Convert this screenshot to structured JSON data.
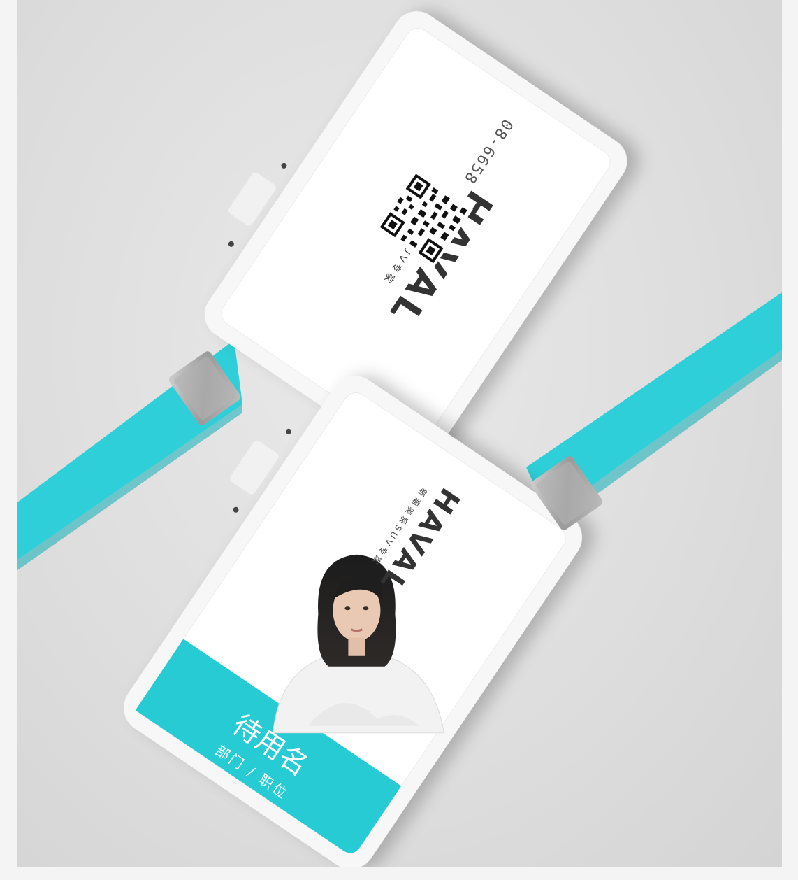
{
  "top_card": {
    "logo": "HAVAL",
    "tagline": "新潮美系SUV专家",
    "id_number": "08-6658"
  },
  "bottom_card": {
    "logo": "HAVAL",
    "tagline": "新潮美系SUV专家",
    "name": "待用名",
    "department": "部门 / 职位"
  },
  "colors": {
    "lanyard": "#2ecfd8",
    "name_band": "#27cbd4",
    "card": "#ffffff",
    "clip": "#a9a9a9"
  }
}
